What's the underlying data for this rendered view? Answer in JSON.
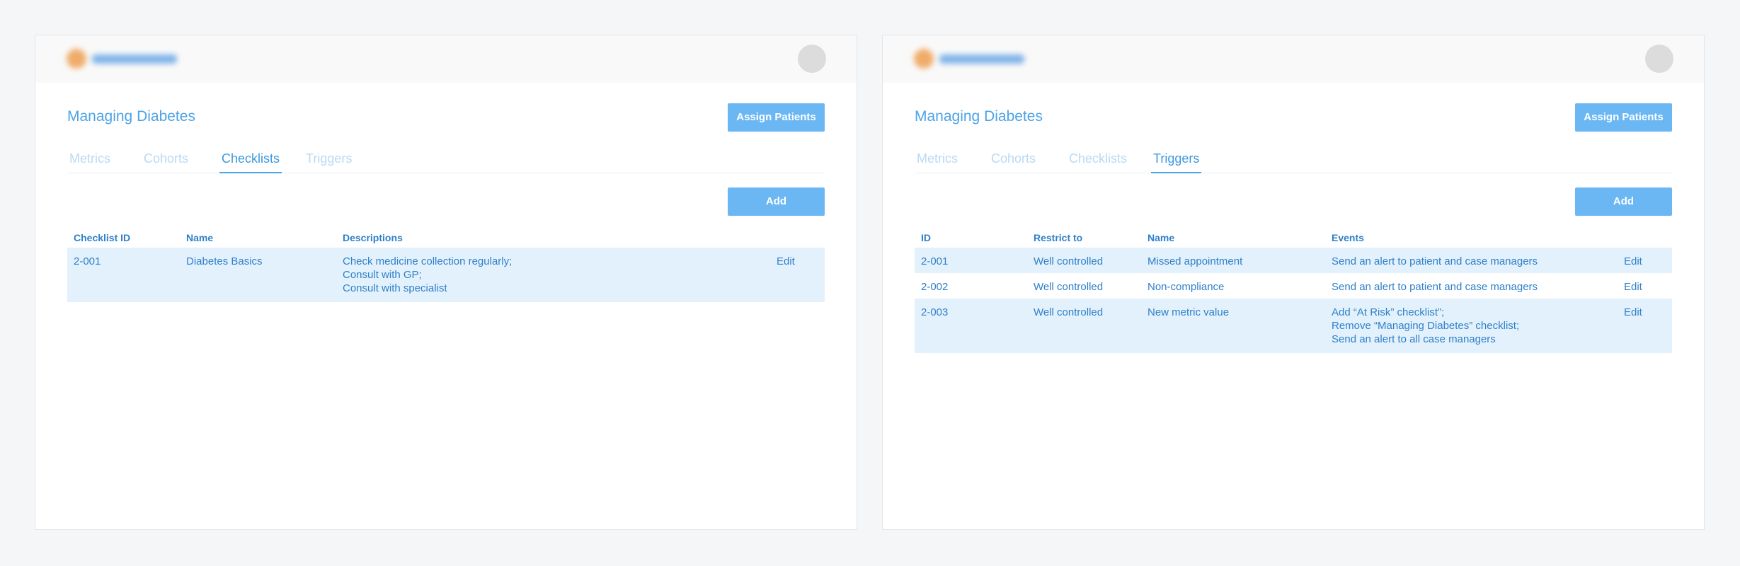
{
  "left_panel": {
    "title": "Managing Diabetes",
    "assign_button": "Assign Patients",
    "add_button": "Add",
    "tabs": [
      {
        "label": "Metrics",
        "active": false
      },
      {
        "label": "Cohorts",
        "active": false
      },
      {
        "label": "Checklists",
        "active": true
      },
      {
        "label": "Triggers",
        "active": false
      }
    ],
    "table": {
      "headers": [
        "Checklist ID",
        "Name",
        "Descriptions"
      ],
      "rows": [
        {
          "id": "2-001",
          "name": "Diabetes Basics",
          "descriptions": [
            "Check medicine collection regularly;",
            "Consult with GP;",
            "Consult with specialist"
          ],
          "action": "Edit"
        }
      ]
    }
  },
  "right_panel": {
    "title": "Managing Diabetes",
    "assign_button": "Assign Patients",
    "add_button": "Add",
    "tabs": [
      {
        "label": "Metrics",
        "active": false
      },
      {
        "label": "Cohorts",
        "active": false
      },
      {
        "label": "Checklists",
        "active": false
      },
      {
        "label": "Triggers",
        "active": true
      }
    ],
    "table": {
      "headers": [
        "ID",
        "Restrict to",
        "Name",
        "Events"
      ],
      "rows": [
        {
          "id": "2-001",
          "restrict": "Well controlled",
          "name": "Missed appointment",
          "events": [
            "Send an alert to patient and case managers"
          ],
          "action": "Edit"
        },
        {
          "id": "2-002",
          "restrict": "Well controlled",
          "name": "Non-compliance",
          "events": [
            "Send an alert to patient and case managers"
          ],
          "action": "Edit"
        },
        {
          "id": "2-003",
          "restrict": "Well controlled",
          "name": "New metric value",
          "events": [
            "Add “At Risk” checklist”;",
            "Remove “Managing Diabetes” checklist;",
            "Send an alert to all case managers"
          ],
          "action": "Edit"
        }
      ]
    }
  },
  "icons": {
    "logo": "brand-logo-icon",
    "avatar": "user-avatar-icon"
  },
  "colors": {
    "accent": "#6bb7f3",
    "text": "#2f80c9",
    "row_highlight": "#e3f1fc",
    "avatar": "#dcdcdc"
  }
}
